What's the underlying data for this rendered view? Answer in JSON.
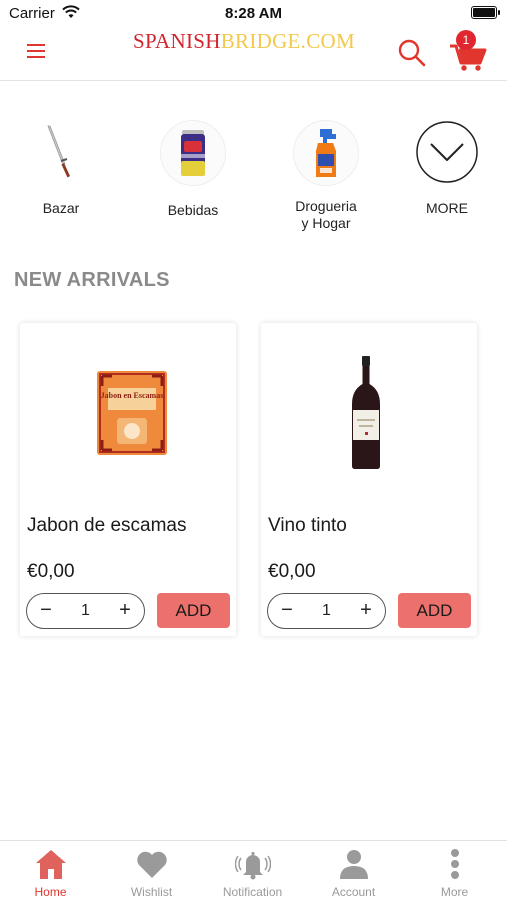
{
  "status_bar": {
    "carrier": "Carrier",
    "time": "8:28 AM"
  },
  "header": {
    "logo_part1": "SPANISH",
    "logo_part2": "BRIDGE.COM",
    "cart_count": "1"
  },
  "categories": [
    {
      "label": "Bazar",
      "icon": "knife-icon"
    },
    {
      "label": "Bebidas",
      "icon": "soda-can-icon"
    },
    {
      "label_line1": "Drogueria",
      "label_line2": "y Hogar",
      "icon": "spray-bottle-icon"
    },
    {
      "label": "MORE",
      "icon": "chevron-down-icon"
    }
  ],
  "section": {
    "title": "NEW ARRIVALS"
  },
  "products": [
    {
      "name": "Jabon de escamas",
      "price": "€0,00",
      "quantity": "1",
      "add_label": "ADD",
      "image": "soap-flakes-package-image",
      "package_text": "Jabon en Escamas"
    },
    {
      "name": "Vino tinto",
      "price": "€0,00",
      "quantity": "1",
      "add_label": "ADD",
      "image": "wine-bottle-image"
    }
  ],
  "stepper": {
    "minus": "−",
    "plus": "+"
  },
  "bottom_nav": [
    {
      "label": "Home",
      "icon": "home-icon",
      "active": true
    },
    {
      "label": "Wishlist",
      "icon": "heart-icon"
    },
    {
      "label": "Notification",
      "icon": "bell-icon"
    },
    {
      "label": "Account",
      "icon": "user-icon"
    },
    {
      "label": "More",
      "icon": "more-vertical-icon"
    }
  ],
  "colors": {
    "accent": "#e0362e",
    "add_button": "#ec706b",
    "logo_red": "#d0252c",
    "logo_yellow": "#f2c94c"
  }
}
